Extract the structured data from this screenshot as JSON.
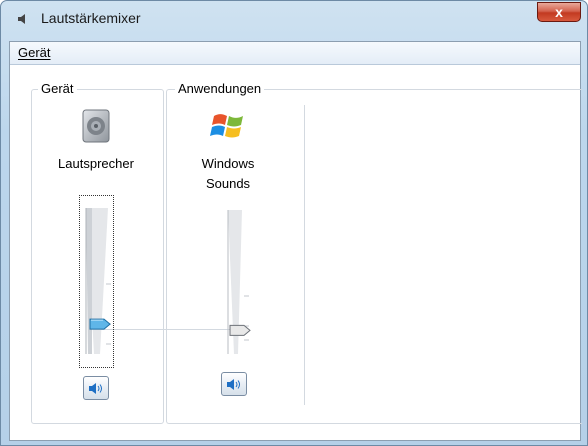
{
  "window": {
    "title": "Lautstärkemixer",
    "close_glyph": "x"
  },
  "menu": {
    "items": [
      {
        "label": "Gerät"
      }
    ]
  },
  "device_group": {
    "label": "Gerät",
    "device": {
      "name": "Lautsprecher",
      "icon": "speaker-icon",
      "volume_percent": 15
    }
  },
  "applications_group": {
    "label": "Anwendungen",
    "apps": [
      {
        "name_line1": "Windows",
        "name_line2": "Sounds",
        "icon": "windows-logo-icon",
        "volume_percent": 15
      }
    ]
  },
  "colors": {
    "thumb_active": "#5fb6e8",
    "thumb_inactive": "#e8e8e8",
    "close_red": "#c23a21"
  }
}
